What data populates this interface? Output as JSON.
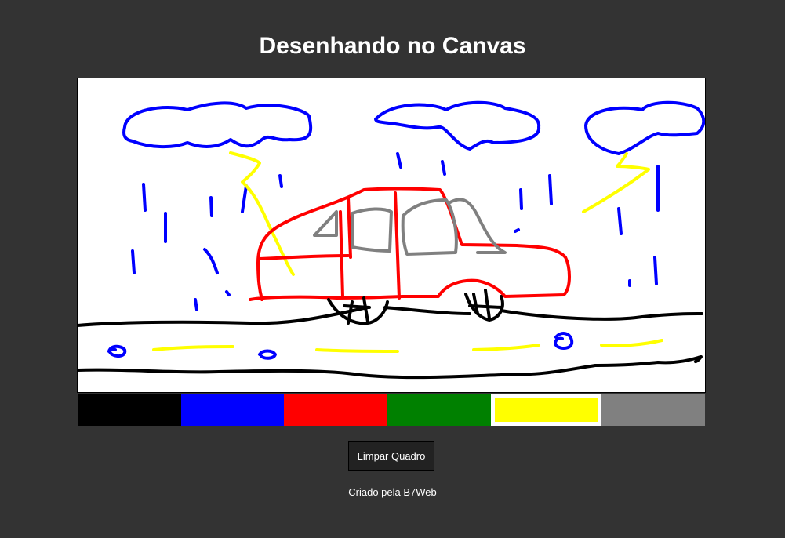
{
  "title": "Desenhando no Canvas",
  "palette": {
    "colors": [
      "#000000",
      "#0000ff",
      "#ff0000",
      "#008000",
      "#ffff00",
      "#808080"
    ],
    "selected_index": 4
  },
  "clear_button": {
    "label": "Limpar Quadro"
  },
  "footer": {
    "text": "Criado pela B7Web"
  }
}
